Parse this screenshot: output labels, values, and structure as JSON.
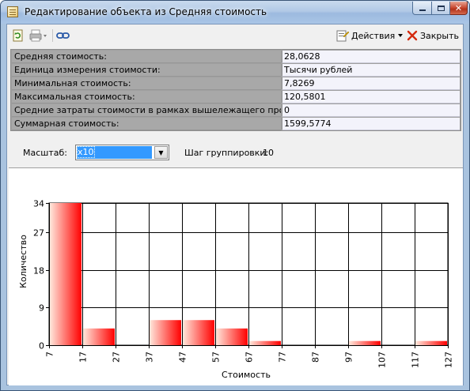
{
  "window": {
    "title": "Редактирование объекта  из Средняя стоимость"
  },
  "toolbar": {
    "refresh_icon": "refresh-icon",
    "print_icon": "print-icon",
    "link_icon": "link-icon",
    "actions_label": "Действия",
    "close_label": "Закрыть"
  },
  "properties": [
    {
      "label": "Средняя стоимость:",
      "value": "28,0628"
    },
    {
      "label": "Единица измерения стоимости:",
      "value": "Тысячи рублей"
    },
    {
      "label": "Минимальная стоимость:",
      "value": "7,8269"
    },
    {
      "label": "Максимальная стоимость:",
      "value": "120,5801"
    },
    {
      "label": "Средние затраты стоимости в рамках вышележащего процесса:",
      "value": "0"
    },
    {
      "label": "Суммарная стоимость:",
      "value": "1599,5774"
    }
  ],
  "scale": {
    "label": "Масштаб:",
    "selected": "x10",
    "group_label": "Шаг группировки:",
    "group_value": "10"
  },
  "colors": {
    "bar_dark": "#ff0000",
    "bar_light": "#ffe8dc",
    "window_frame": "#a9c3df"
  },
  "chart_data": {
    "type": "bar",
    "xlabel": "Стоимость",
    "ylabel": "Количество",
    "x_ticks": [
      "7",
      "17",
      "27",
      "37",
      "47",
      "57",
      "67",
      "77",
      "87",
      "97",
      "107",
      "117",
      "127"
    ],
    "y_ticks": [
      "0",
      "9",
      "18",
      "27",
      "34"
    ],
    "bins": [
      {
        "from": 7,
        "to": 17,
        "count": 34
      },
      {
        "from": 17,
        "to": 27,
        "count": 4
      },
      {
        "from": 27,
        "to": 37,
        "count": 0
      },
      {
        "from": 37,
        "to": 47,
        "count": 6
      },
      {
        "from": 47,
        "to": 57,
        "count": 6
      },
      {
        "from": 57,
        "to": 67,
        "count": 4
      },
      {
        "from": 67,
        "to": 77,
        "count": 1
      },
      {
        "from": 77,
        "to": 87,
        "count": 0
      },
      {
        "from": 87,
        "to": 97,
        "count": 0
      },
      {
        "from": 97,
        "to": 107,
        "count": 1
      },
      {
        "from": 107,
        "to": 117,
        "count": 0
      },
      {
        "from": 117,
        "to": 127,
        "count": 1
      }
    ],
    "xlim": [
      7,
      127
    ],
    "ylim": [
      0,
      34
    ],
    "grid": true
  }
}
